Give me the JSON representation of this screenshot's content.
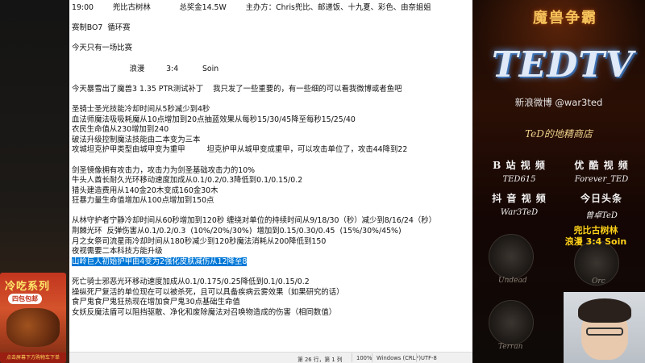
{
  "ad": {
    "title": "冷吃系列",
    "badge": "四包包邮",
    "footer": "点击屏幕下方购物车下单"
  },
  "notepad": {
    "lines": [
      {
        "text": "19:00        兜比古树林            总奖金14.5W        主办方：Chris兜比、邮递饭、十九夏、彩色、由奈姐姐",
        "selected": false
      },
      {
        "text": "",
        "selected": false
      },
      {
        "text": "赛制BO7  循环赛",
        "selected": false
      },
      {
        "text": "",
        "selected": false
      },
      {
        "text": "今天只有一场比赛",
        "selected": false
      },
      {
        "text": "",
        "selected": false
      },
      {
        "text": "                        浪漫         3:4          Soin",
        "selected": false
      },
      {
        "text": "",
        "selected": false
      },
      {
        "text": "今天暴雪出了魔兽3 1.35 PTR测试补丁    我只发了一些重要的，有一些细的可以看我微博或者鱼吧",
        "selected": false
      },
      {
        "text": "",
        "selected": false
      },
      {
        "text": "圣骑士圣光技能冷却时间从5秒减少到4秒",
        "selected": false
      },
      {
        "text": "血法师魔法吸吸耗魔从10点增加到20点抽蓝效果从每秒15/30/45降至每秒15/25/40",
        "selected": false
      },
      {
        "text": "农民生命值从230增加到240",
        "selected": false
      },
      {
        "text": "破法升级控制魔法技能由二本变为三本",
        "selected": false
      },
      {
        "text": "攻城坦克护甲类型由城甲变为重甲         坦克护甲从城甲变成重甲，可以攻击单位了，攻击44降到22",
        "selected": false
      },
      {
        "text": "",
        "selected": false
      },
      {
        "text": "剑圣镜像拥有攻击力，攻击力为剑圣基础攻击力的10%",
        "selected": false
      },
      {
        "text": "牛头人酋长耐久光环移动速度加成从0.1/0.2/0.3降低到0.1/0.15/0.2",
        "selected": false
      },
      {
        "text": "猎头建造费用从140金20木变成160金30木",
        "selected": false
      },
      {
        "text": "狂暴力量生命值增加从100点增加到150点",
        "selected": false
      },
      {
        "text": "",
        "selected": false
      },
      {
        "text": "从林守护者宁静冷却时间从60秒增加到120秒 缠绕对单位的持续时间从9/18/30（秒）减少到8/16/24（秒）",
        "selected": false
      },
      {
        "text": "荆棘光环  反弹伤害从0.1/0.2/0.3  (10%/20%/30%)  增加到0.15/0.30/0.45  (15%/30%/45%)",
        "selected": false
      },
      {
        "text": "月之女祭司流星雨冷却时间从180秒减少到120秒魔法消耗从200降低到150",
        "selected": false
      },
      {
        "text": "夜视需要二本科技方能升级",
        "selected": false
      },
      {
        "text": "山岭巨人初始护甲由4变为2强化皮肤减伤从12降至8",
        "selected": true
      },
      {
        "text": "",
        "selected": false
      },
      {
        "text": "死亡骑士邪恶光环移动速度加成从0.1/0.175/0.25降低到0.1/0.15/0.2",
        "selected": false
      },
      {
        "text": "操纵死尸复活的单位现在可以被杀死，且可以具备疾病云雾效果（如果研究的话）",
        "selected": false
      },
      {
        "text": "食尸鬼食尸鬼狂热现在增加食尸鬼30点基础生命值",
        "selected": false
      },
      {
        "text": "女妖反魔法盾可以阻挡驱散、净化和废除魔法对召唤物造成的伤害（相同数值）",
        "selected": false
      }
    ],
    "status": {
      "position": "第 26 行，第 1 列",
      "zoom": "100%",
      "line_ending": "Windows (CRLF)",
      "encoding": "UTF-8"
    }
  },
  "right_panel": {
    "brand": "魔兽争霸",
    "logo": "TEDTV",
    "weibo": "新浪微博 @war3ted",
    "shop_title": "TeD的地精商店",
    "socials": [
      {
        "name": "B 站 视 频",
        "handle": "TED615"
      },
      {
        "name": "优 酷 视 频",
        "handle": "Forever_TED"
      },
      {
        "name": "抖 音 视 频",
        "handle": "War3TeD"
      },
      {
        "name": "今日头条",
        "handle": "曾卓TeD"
      }
    ],
    "match_caption": {
      "line1": "兜比古树林",
      "line2": "浪漫 3:4 Soin"
    },
    "races": [
      "Undead",
      "Orc",
      "Terran"
    ]
  }
}
